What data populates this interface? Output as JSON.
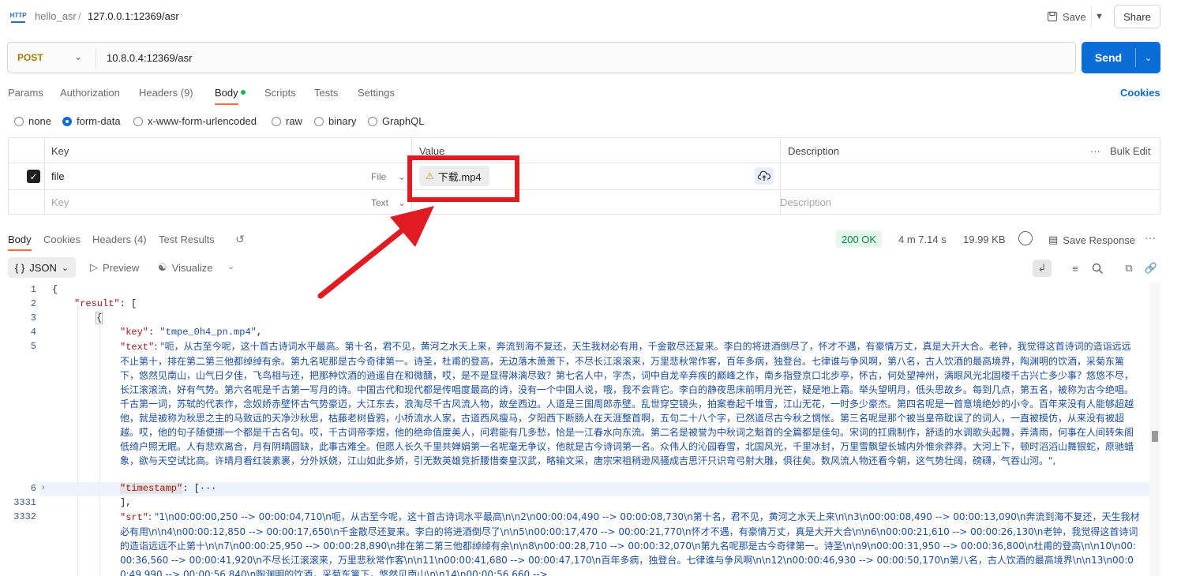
{
  "header": {
    "collection": "hello_asr",
    "separator": "/",
    "request_name": "127.0.0.1:12369/asr",
    "save_label": "Save",
    "share_label": "Share"
  },
  "request": {
    "method": "POST",
    "url": "10.8.0.4:12369/asr",
    "send_label": "Send",
    "tabs": [
      "Params",
      "Authorization",
      "Headers (9)",
      "Body",
      "Scripts",
      "Tests",
      "Settings"
    ],
    "cookies_label": "Cookies",
    "body_modes": [
      "none",
      "form-data",
      "x-www-form-urlencoded",
      "raw",
      "binary",
      "GraphQL"
    ],
    "selected_mode": "form-data"
  },
  "form_table": {
    "headers": {
      "key": "Key",
      "value": "Value",
      "description": "Description",
      "bulk_edit": "Bulk Edit"
    },
    "row": {
      "key": "file",
      "type": "File",
      "value": "下载.mp4"
    },
    "placeholder_row": {
      "key": "Key",
      "type": "Text",
      "description": "Description"
    }
  },
  "response": {
    "tabs": [
      "Body",
      "Cookies",
      "Headers (4)",
      "Test Results"
    ],
    "status": "200 OK",
    "time": "4 m 7.14 s",
    "size": "19.99 KB",
    "save_response": "Save Response",
    "format": "JSON",
    "preview_label": "Preview",
    "visualize_label": "Visualize"
  },
  "code": {
    "line_numbers": [
      "1",
      "2",
      "3",
      "4",
      "5",
      "6",
      "3331",
      "3332"
    ],
    "l1": "{",
    "l2_key": "\"result\"",
    "l2_rest": ": [",
    "l3": "{",
    "l4_key": "\"key\"",
    "l4_val": "\"tmpe_0h4_pn.mp4\"",
    "l5_key": "\"text\"",
    "l5_val": "\"呃，从古至今呢，这十首古诗词水平最高。第十名，君不见，黄河之水天上来，奔流到海不复还，天生我材必有用，千金散尽还复来。李白的将进酒倒尽了，怀才不遇，有豪情万丈，真是大开大合。老钟，我觉得这首诗词的造诣远远不止第十，排在第二第三他都绰绰有余。第九名呢那是古今奇律第一。诗圣，杜甫的登高，无边落木萧萧下，不尽长江滚滚来，万里悲秋常作客，百年多病，独登台。七律谁与争风啊，第八名，古人饮酒的最高境界，陶渊明的饮酒，采菊东篱下，悠然见南山，山气日夕佳，飞鸟相与还，把那种饮酒的逍遥自在和微醺，哎，是不是显得淋漓尽致？第七名人中，字杰，词中自龙辛弃疾的巅峰之作，南乡指登京口北步亭，怀古，何处望神州，满眼风光北固楼千古兴亡多少事？悠悠不尽，长江滚滚流，好有气势。第六名呢是千古第一写月的诗。中国古代和现代都是传唱度最高的诗，没有一个中国人说，哦，我不会背它。李白的静夜思床前明月光芒，疑是地上霜。举头望明月，低头思故乡。每到几点，第五名，被称为古今绝唱。千古第一词，苏轼的代表作，念奴娇赤壁怀古气势豪迈，大江东去，浪淘尽千古风流人物，故垒西边。人道是三国周郎赤壁。乱世穿空镜头，拍案卷起千堆雪，江山无花，一时多少豪杰。第四名呢是一首意境绝妙的小令。百年来没有人能够超越他，就是被称为秋思之主的马致远的天净沙秋思，枯藤老树昏鸦，小桥流水人家，古道西风瘦马，夕阳西下断肠人在天涯整首啊，五句二十八个字，已然道尽古今秋之惆怅。第三名呢是那个被当皇帝耽误了的词人，一直被模仿，从来没有被超越。哎，他的句子随便挪一个都是千古名句。哎，千古词帝李煜，他的绝命值度美人，问君能有几多愁，恰是一江春水向东流。第二名是被誉为中秋词之魁首的全篇都是佳句。宋词的扛鼎制作，舒适的水调歌头起舞，弄清雨，何事在人间转朱阁低绮户照无眠。人有悲欢离合，月有阴晴圆缺，此事古难全。但愿人长久千里共婵娟第一名呢毫无争议，他就是古今诗词第一名。众伟人的沁园春雪，北国风光，千里冰封，万里雪飘望长城内外惟余莽莽。大河上下，顿时滔滔山舞银蛇，原驰蜡象，欲与天空试比高。许晴月看红装素裹，分外妖娆，江山如此多娇，引无数英雄竞折腰惜秦皇汉武，略输文采，唐宗宋祖稍逊风骚成吉思汗只识弯弓射大雕，俱往矣。数风流人物还看今朝，这气势壮阔，磅礴，气吞山河。\",",
    "l6_key": "\"timestamp\"",
    "l6_rest": ": [···",
    "l3331": "],",
    "l3332_key": "\"srt\"",
    "l3332_val": "\"1\\n00:00:00,250 --> 00:00:04,710\\n呃，从古至今呢，这十首古诗词水平最高\\n\\n2\\n00:00:04,490 --> 00:00:08,730\\n第十名，君不见，黄河之水天上来\\n\\n3\\n00:00:08,490 --> 00:00:13,090\\n奔流到海不复还，天生我材必有用\\n\\n4\\n00:00:12,850 --> 00:00:17,650\\n千金散尽还复来。李白的将进酒倒尽了\\n\\n5\\n00:00:17,470 --> 00:00:21,770\\n怀才不遇，有豪情万丈，真是大开大合\\n\\n6\\n00:00:21,610 --> 00:00:26,130\\n老钟，我觉得这首诗词的造诣远远不止第十\\n\\n7\\n00:00:25,950 --> 00:00:28,890\\n排在第二第三他都绰绰有余\\n\\n8\\n00:00:28,710 --> 00:00:32,070\\n第九名呢那是古今奇律第一。诗圣\\n\\n9\\n00:00:31,950 --> 00:00:36,800\\n杜甫的登高\\n\\n10\\n00:00:36,560 --> 00:00:41,920\\n不尽长江滚滚来，万里悲秋常作客\\n\\n11\\n00:00:41,680 --> 00:00:47,170\\n百年多病，独登台。七律谁与争风啊\\n\\n12\\n00:00:46,930 --> 00:00:50,170\\n第八名，古人饮酒的最高境界\\n\\n13\\n00:00:49,990 --> 00:00:56,840\\n陶渊明的饮酒，采菊东篱下，悠然见南山\\n\\n14\\n00:00:56,660 -->"
  }
}
